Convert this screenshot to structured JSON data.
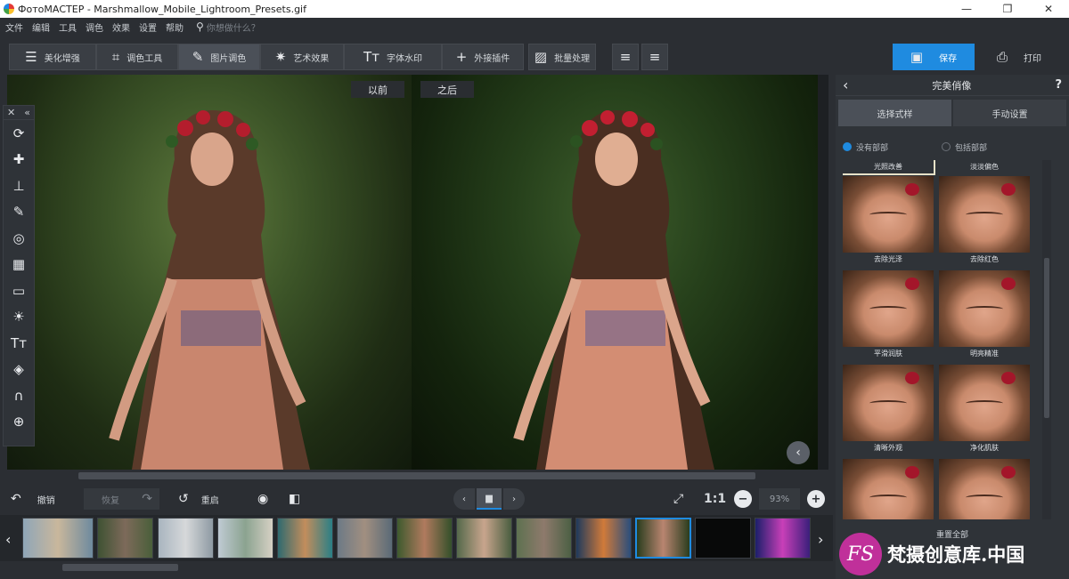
{
  "window": {
    "title": "ФотоМАСТЕР - Marshmallow_Mobile_Lightroom_Presets.gif",
    "minimize": "—",
    "maximize": "❐",
    "close": "✕"
  },
  "menu": [
    "文件",
    "编辑",
    "工具",
    "调色",
    "效果",
    "设置",
    "帮助"
  ],
  "search_placeholder": "你想做什么？",
  "toolbar": {
    "tabs": [
      {
        "label": "美化增强",
        "icon": "sliders-icon"
      },
      {
        "label": "调色工具",
        "icon": "crop-icon"
      },
      {
        "label": "图片调色",
        "icon": "brush-icon"
      },
      {
        "label": "艺术效果",
        "icon": "magic-wand-icon"
      },
      {
        "label": "字体水印",
        "icon": "text-icon"
      },
      {
        "label": "外接插件",
        "icon": "plus-icon"
      },
      {
        "label": "批量处理",
        "icon": "images-icon"
      }
    ],
    "save": "保存",
    "print": "打印"
  },
  "compare": {
    "before": "以前",
    "after": "之后"
  },
  "left_tools": [
    "crop-rotate-icon",
    "healing-icon",
    "clone-stamp-icon",
    "brush-icon",
    "radial-filter-icon",
    "gradient-filter-icon",
    "vignette-icon",
    "light-icon",
    "text-icon",
    "fill-icon",
    "magnet-icon",
    "globe-icon"
  ],
  "left_panel_header": {
    "close": "✕",
    "collapse": "«"
  },
  "bottom": {
    "undo": "撤销",
    "redo": "恢复",
    "reset": "重启",
    "ratio": "1:1",
    "zoom": "93%"
  },
  "right_panel": {
    "title": "完美俏像",
    "help": "?",
    "tabs": [
      "选择式样",
      "手动设置"
    ],
    "radios": [
      "没有部部",
      "包括部部"
    ],
    "top_captions": [
      "光照改善",
      "淡淡偏色"
    ],
    "presets": [
      "去除光泽",
      "去除红色",
      "平滑润肤",
      "明亮精准",
      "清晰外观",
      "净化肌肤",
      "",
      ""
    ],
    "reset_all": "重置全部"
  },
  "watermark": {
    "logo": "FS",
    "text": "梵摄创意库.中国"
  },
  "colors": {
    "accent": "#1f8be0",
    "background": "#2b2e33",
    "panel": "#2f3338"
  }
}
